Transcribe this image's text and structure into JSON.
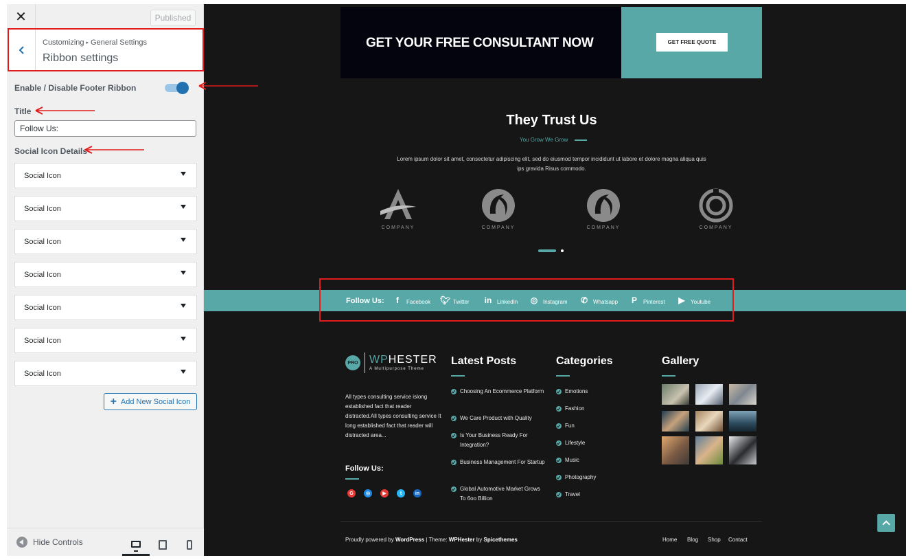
{
  "customizer": {
    "close_icon": "close-icon",
    "publish_label": "Published",
    "breadcrumb": {
      "root": "Customizing",
      "separator": "▸",
      "section": "General Settings"
    },
    "section_title": "Ribbon settings",
    "toggle": {
      "label": "Enable / Disable Footer Ribbon",
      "enabled": true
    },
    "title_field": {
      "label": "Title",
      "value": "Follow Us:"
    },
    "social_details_label": "Social Icon Details",
    "social_items": [
      {
        "label": "Social Icon"
      },
      {
        "label": "Social Icon"
      },
      {
        "label": "Social Icon"
      },
      {
        "label": "Social Icon"
      },
      {
        "label": "Social Icon"
      },
      {
        "label": "Social Icon"
      },
      {
        "label": "Social Icon"
      }
    ],
    "add_button_label": "Add New Social Icon",
    "hide_controls_label": "Hide Controls",
    "devices": [
      "desktop-icon",
      "tablet-icon",
      "mobile-icon"
    ],
    "accent_color": "#2271b1",
    "annotation_color": "#e11c1c"
  },
  "preview": {
    "cta": {
      "text": "GET YOUR FREE CONSULTANT NOW",
      "button": "GET FREE QUOTE",
      "accent": "#57a8a7"
    },
    "trust": {
      "title": "They Trust Us",
      "subtitle": "You Grow We Grow",
      "description": "Lorem ipsum dolor sit amet, consectetur adipiscing elit, sed do eiusmod tempor incididunt ut labore et dolore magna aliqua quis ips gravida Risus commodo.",
      "logo_text": "COMPANY"
    },
    "ribbon": {
      "title": "Follow Us:",
      "items": [
        {
          "label": "Facebook",
          "icon": "facebook-icon"
        },
        {
          "label": "Twitter",
          "icon": "twitter-icon"
        },
        {
          "label": "LinkedIn",
          "icon": "linkedin-icon"
        },
        {
          "label": "Instagram",
          "icon": "instagram-icon"
        },
        {
          "label": "Whatsapp",
          "icon": "whatsapp-icon"
        },
        {
          "label": "Pinterest",
          "icon": "pinterest-icon"
        },
        {
          "label": "Youtube",
          "icon": "youtube-icon"
        }
      ]
    },
    "footer": {
      "brand": {
        "badge": "PRO",
        "name_a": "WP",
        "name_b": "HESTER",
        "tagline": "A Multipurpose Theme"
      },
      "about": "All types consulting service islong established fact that reader distracted.All types consulting service It long established fact that reader will distracted area...",
      "follow_title": "Follow Us:",
      "latest_title": "Latest Posts",
      "posts": [
        "Choosing An Ecommerce Platform",
        "We Care Product with Quality",
        "Is Your Business Ready For Integration?",
        "Business Management For Startup",
        "Global Automotive Market Grows To 6oo Billion"
      ],
      "categories_title": "Categories",
      "categories": [
        "Emotions",
        "Fashion",
        "Fun",
        "Lifestyle",
        "Music",
        "Photography",
        "Travel"
      ],
      "gallery_title": "Gallery",
      "copyright": {
        "prefix": "Proudly powered by",
        "wp": "WordPress",
        "mid": "| Theme:",
        "theme": "WPHester",
        "by": "by",
        "author": "Spicethemes"
      },
      "nav": [
        "Home",
        "Blog",
        "Shop",
        "Contact"
      ]
    }
  }
}
